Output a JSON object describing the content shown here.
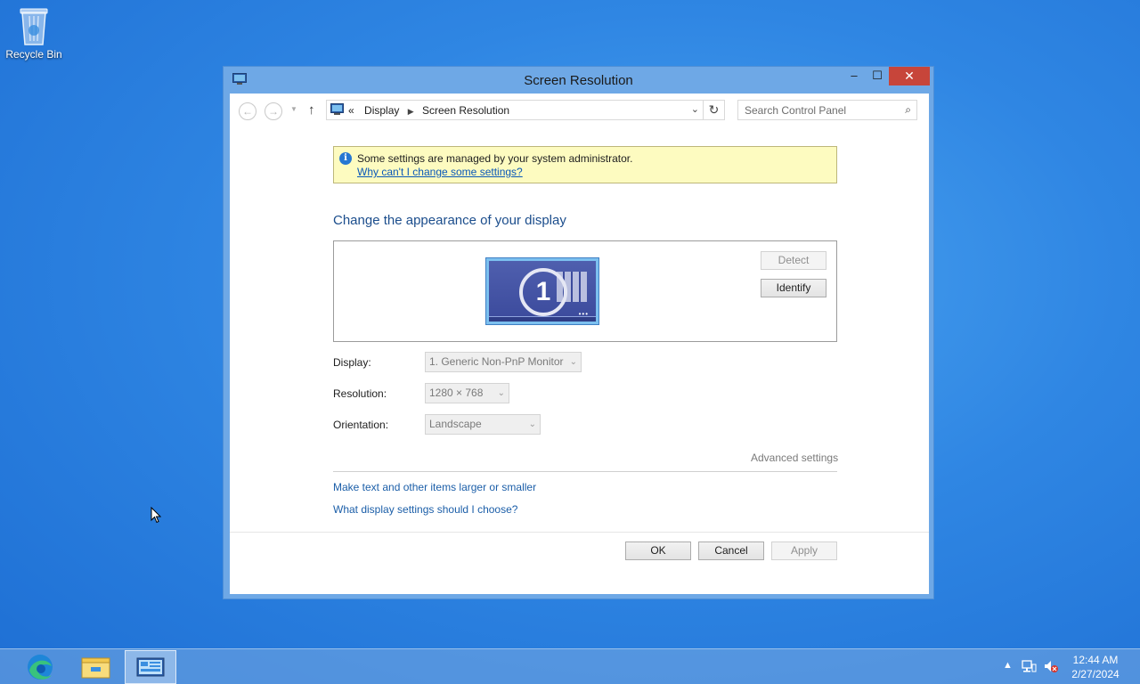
{
  "desktop": {
    "recycle_bin_label": "Recycle Bin"
  },
  "window": {
    "title": "Screen Resolution",
    "minimize_glyph": "–",
    "maximize_glyph": "☐",
    "close_glyph": "✕",
    "nav": {
      "back_glyph": "←",
      "forward_glyph": "→",
      "dropdown_glyph": "▼",
      "up_glyph": "↑",
      "breadcrumb_overflow": "«",
      "breadcrumb": [
        "Display",
        "Screen Resolution"
      ],
      "breadcrumb_sep": "▶",
      "address_dropdown_glyph": "⌄",
      "refresh_glyph": "↻",
      "search_placeholder": "Search Control Panel",
      "search_glyph": "⌕"
    },
    "infobar": {
      "icon_glyph": "i",
      "message": "Some settings are managed by your system administrator.",
      "link": "Why can't I change some settings?"
    },
    "heading": "Change the appearance of your display",
    "monitor": {
      "number": "1",
      "dots": "•••"
    },
    "detect_label": "Detect",
    "identify_label": "Identify",
    "fields": {
      "display_label": "Display:",
      "display_value": "1. Generic Non-PnP Monitor",
      "resolution_label": "Resolution:",
      "resolution_value": "1280 × 768",
      "orientation_label": "Orientation:",
      "orientation_value": "Landscape",
      "combo_arrow": "⌄"
    },
    "advanced_settings": "Advanced settings",
    "links": {
      "text_size": "Make text and other items larger or smaller",
      "help": "What display settings should I choose?"
    },
    "buttons": {
      "ok": "OK",
      "cancel": "Cancel",
      "apply": "Apply"
    }
  },
  "taskbar": {
    "items": [
      "edge-icon",
      "file-explorer-icon",
      "control-panel-icon"
    ],
    "tray": {
      "chevron": "▲",
      "time": "12:44 AM",
      "date": "2/27/2024"
    }
  },
  "colors": {
    "accent": "#2f86e3",
    "close": "#c7453a",
    "link": "#1b5ea8",
    "heading": "#1b4d8c",
    "infobar": "#fdfbc0"
  }
}
